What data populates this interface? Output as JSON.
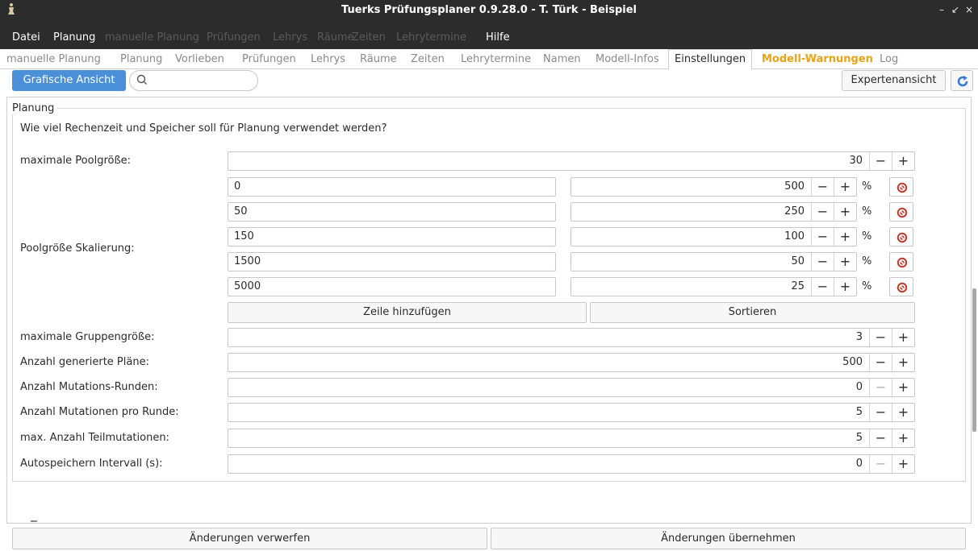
{
  "window": {
    "title": "Tuerks Prüfungsplaner 0.9.28.0 - T. Türk - Beispiel",
    "app_icon": "app-figure-icon",
    "minimize_glyph": "–",
    "restore_glyph": "↙",
    "close_glyph": "×"
  },
  "menu": {
    "items": [
      {
        "label": "Datei",
        "enabled": true
      },
      {
        "label": "Planung",
        "enabled": true
      },
      {
        "label": "manuelle Planung",
        "enabled": false
      },
      {
        "label": "Prüfungen",
        "enabled": false
      },
      {
        "label": "Lehrys",
        "enabled": false
      },
      {
        "label": "Räume",
        "enabled": false
      },
      {
        "label": "Zeiten",
        "enabled": false
      },
      {
        "label": "Lehrytermine",
        "enabled": false
      },
      {
        "label": "Hilfe",
        "enabled": true
      }
    ]
  },
  "tabs": [
    {
      "label": "manuelle Planung"
    },
    {
      "label": "Planung"
    },
    {
      "label": "Vorlieben"
    },
    {
      "label": "Prüfungen"
    },
    {
      "label": "Lehrys"
    },
    {
      "label": "Räume"
    },
    {
      "label": "Zeiten"
    },
    {
      "label": "Lehrytermine"
    },
    {
      "label": "Namen"
    },
    {
      "label": "Modell-Infos"
    },
    {
      "label": "Einstellungen",
      "active": true
    },
    {
      "label": "Modell-Warnungen",
      "warning": true
    },
    {
      "label": "Log"
    }
  ],
  "toolbar": {
    "graphic_view_label": "Grafische Ansicht",
    "search_placeholder": "",
    "expert_view_label": "Expertenansicht",
    "refresh_icon": "refresh-icon"
  },
  "planung": {
    "group_title": "Planung",
    "description": "Wie viel Rechenzeit und Speicher soll für Planung verwendet werden?",
    "max_pool": {
      "label": "maximale Poolgröße:",
      "value": "30"
    },
    "scaling": {
      "label": "Poolgröße Skalierung:",
      "unit": "%",
      "rows": [
        {
          "threshold": "0",
          "percent": "500"
        },
        {
          "threshold": "50",
          "percent": "250"
        },
        {
          "threshold": "150",
          "percent": "100"
        },
        {
          "threshold": "1500",
          "percent": "50"
        },
        {
          "threshold": "5000",
          "percent": "25"
        }
      ],
      "add_row_label": "Zeile hinzufügen",
      "sort_label": "Sortieren"
    },
    "settings": [
      {
        "label": "maximale Gruppengröße:",
        "value": "3",
        "minus_enabled": true
      },
      {
        "label": "Anzahl generierte Pläne:",
        "value": "500",
        "minus_enabled": true
      },
      {
        "label": "Anzahl Mutations-Runden:",
        "value": "0",
        "minus_enabled": false
      },
      {
        "label": "Anzahl Mutationen pro Runde:",
        "value": "5",
        "minus_enabled": true
      },
      {
        "label": "max. Anzahl Teilmutationen:",
        "value": "5",
        "minus_enabled": true
      },
      {
        "label": "Autospeichern Intervall (s):",
        "value": "0",
        "minus_enabled": false
      }
    ],
    "minus_glyph": "−",
    "plus_glyph": "+"
  },
  "footer": {
    "discard_label": "Änderungen verwerfen",
    "apply_label": "Änderungen übernehmen"
  },
  "colors": {
    "titlebar_bg": "#2c2c2c",
    "accent_blue": "#4a90d9",
    "warning_orange": "#e8a317",
    "remove_red": "#c0392b"
  }
}
